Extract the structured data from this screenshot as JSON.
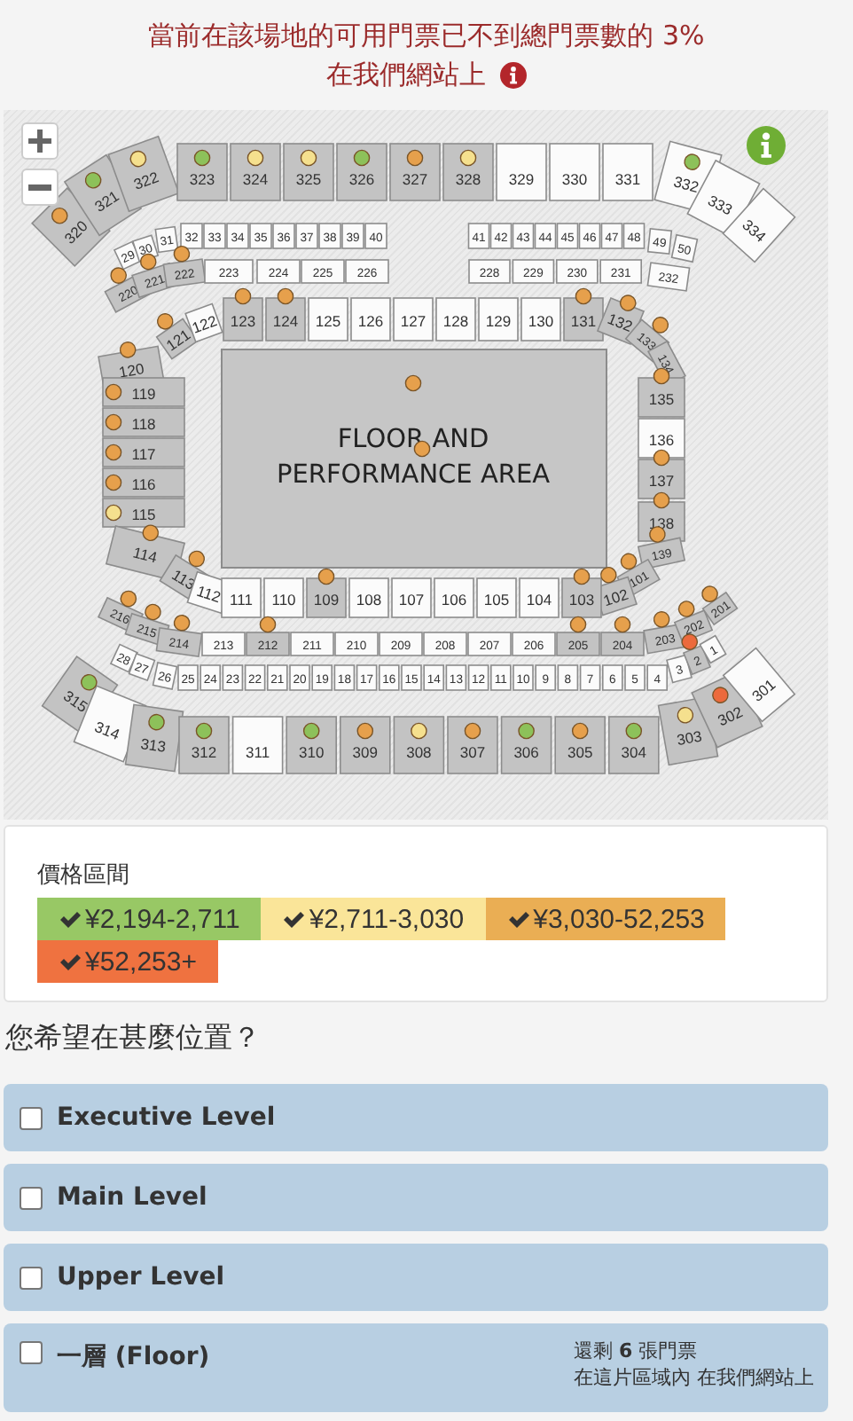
{
  "notice": {
    "line1": "當前在該場地的可用門票已不到總門票數的 3%",
    "line2": "在我們網站上"
  },
  "map": {
    "floor": {
      "lines": [
        "FLOOR AND",
        "PERFORMANCE AREA"
      ],
      "dots": [
        {
          "color": "#e6a04c"
        },
        {
          "color": "#e6a04c"
        }
      ]
    },
    "sections": [
      {
        "label": "320",
        "available": true,
        "color": "#e6a04c"
      },
      {
        "label": "321",
        "available": true,
        "color": "#8dc15a"
      },
      {
        "label": "322",
        "available": true,
        "color": "#f5e08e"
      },
      {
        "label": "323",
        "available": true,
        "color": "#8dc15a"
      },
      {
        "label": "324",
        "available": true,
        "color": "#f5e08e"
      },
      {
        "label": "325",
        "available": true,
        "color": "#f5e08e"
      },
      {
        "label": "326",
        "available": true,
        "color": "#8dc15a"
      },
      {
        "label": "327",
        "available": true,
        "color": "#e6a04c"
      },
      {
        "label": "328",
        "available": true,
        "color": "#f5e08e"
      },
      {
        "label": "329",
        "available": false
      },
      {
        "label": "330",
        "available": false
      },
      {
        "label": "331",
        "available": false
      },
      {
        "label": "332",
        "available": false,
        "color": "#8dc15a"
      },
      {
        "label": "333",
        "available": false
      },
      {
        "label": "334",
        "available": false
      },
      {
        "label": "29",
        "available": false
      },
      {
        "label": "30",
        "available": false
      },
      {
        "label": "31",
        "available": false
      },
      {
        "label": "32",
        "available": false
      },
      {
        "label": "33",
        "available": false
      },
      {
        "label": "34",
        "available": false
      },
      {
        "label": "35",
        "available": false
      },
      {
        "label": "36",
        "available": false
      },
      {
        "label": "37",
        "available": false
      },
      {
        "label": "38",
        "available": false
      },
      {
        "label": "39",
        "available": false
      },
      {
        "label": "40",
        "available": false
      },
      {
        "label": "41",
        "available": false
      },
      {
        "label": "42",
        "available": false
      },
      {
        "label": "43",
        "available": false
      },
      {
        "label": "44",
        "available": false
      },
      {
        "label": "45",
        "available": false
      },
      {
        "label": "46",
        "available": false
      },
      {
        "label": "47",
        "available": false
      },
      {
        "label": "48",
        "available": false
      },
      {
        "label": "49",
        "available": false
      },
      {
        "label": "50",
        "available": false
      },
      {
        "label": "220",
        "available": true,
        "color": "#e6a04c"
      },
      {
        "label": "221",
        "available": true,
        "color": "#e6a04c"
      },
      {
        "label": "222",
        "available": true,
        "color": "#e6a04c"
      },
      {
        "label": "223",
        "available": false
      },
      {
        "label": "224",
        "available": false
      },
      {
        "label": "225",
        "available": false
      },
      {
        "label": "226",
        "available": false
      },
      {
        "label": "228",
        "available": false
      },
      {
        "label": "229",
        "available": false
      },
      {
        "label": "230",
        "available": false
      },
      {
        "label": "231",
        "available": false
      },
      {
        "label": "232",
        "available": false
      },
      {
        "label": "121",
        "available": true,
        "color": "#e6a04c"
      },
      {
        "label": "122",
        "available": false
      },
      {
        "label": "123",
        "available": true,
        "color": "#e6a04c"
      },
      {
        "label": "124",
        "available": true,
        "color": "#e6a04c"
      },
      {
        "label": "125",
        "available": false
      },
      {
        "label": "126",
        "available": false
      },
      {
        "label": "127",
        "available": false
      },
      {
        "label": "128",
        "available": false
      },
      {
        "label": "129",
        "available": false
      },
      {
        "label": "130",
        "available": false
      },
      {
        "label": "131",
        "available": true,
        "color": "#e6a04c"
      },
      {
        "label": "132",
        "available": true,
        "color": "#e6a04c"
      },
      {
        "label": "133",
        "available": true,
        "color": "#e6a04c"
      },
      {
        "label": "134",
        "available": true
      },
      {
        "label": "120",
        "available": true,
        "color": "#e6a04c"
      },
      {
        "label": "119",
        "available": true,
        "color": "#e6a04c"
      },
      {
        "label": "118",
        "available": true,
        "color": "#e6a04c"
      },
      {
        "label": "117",
        "available": true,
        "color": "#e6a04c"
      },
      {
        "label": "116",
        "available": true,
        "color": "#e6a04c"
      },
      {
        "label": "115",
        "available": true,
        "color": "#f5e08e"
      },
      {
        "label": "114",
        "available": true,
        "color": "#e6a04c"
      },
      {
        "label": "113",
        "available": true,
        "color": "#e6a04c"
      },
      {
        "label": "112",
        "available": false
      },
      {
        "label": "135",
        "available": true,
        "color": "#e6a04c"
      },
      {
        "label": "136",
        "available": false
      },
      {
        "label": "137",
        "available": true,
        "color": "#e6a04c"
      },
      {
        "label": "138",
        "available": true,
        "color": "#e6a04c"
      },
      {
        "label": "139",
        "available": true,
        "color": "#e6a04c"
      },
      {
        "label": "101",
        "available": true,
        "color": "#e6a04c"
      },
      {
        "label": "102",
        "available": true,
        "color": "#e6a04c"
      },
      {
        "label": "111",
        "available": false
      },
      {
        "label": "110",
        "available": false
      },
      {
        "label": "109",
        "available": true,
        "color": "#e6a04c"
      },
      {
        "label": "108",
        "available": false
      },
      {
        "label": "107",
        "available": false
      },
      {
        "label": "106",
        "available": false
      },
      {
        "label": "105",
        "available": false
      },
      {
        "label": "104",
        "available": false
      },
      {
        "label": "103",
        "available": true,
        "color": "#e6a04c"
      },
      {
        "label": "216",
        "available": true,
        "color": "#e6a04c"
      },
      {
        "label": "215",
        "available": true,
        "color": "#e6a04c"
      },
      {
        "label": "214",
        "available": true,
        "color": "#e6a04c"
      },
      {
        "label": "213",
        "available": false
      },
      {
        "label": "212",
        "available": true,
        "color": "#e6a04c"
      },
      {
        "label": "211",
        "available": false
      },
      {
        "label": "210",
        "available": false
      },
      {
        "label": "209",
        "available": false
      },
      {
        "label": "208",
        "available": false
      },
      {
        "label": "207",
        "available": false
      },
      {
        "label": "206",
        "available": false
      },
      {
        "label": "205",
        "available": true,
        "color": "#e6a04c"
      },
      {
        "label": "204",
        "available": true,
        "color": "#e6a04c"
      },
      {
        "label": "203",
        "available": true,
        "color": "#e6a04c"
      },
      {
        "label": "202",
        "available": true,
        "color": "#e6a04c"
      },
      {
        "label": "201",
        "available": true,
        "color": "#e6a04c"
      },
      {
        "label": "28",
        "available": false
      },
      {
        "label": "27",
        "available": false
      },
      {
        "label": "26",
        "available": false
      },
      {
        "label": "25",
        "available": false
      },
      {
        "label": "24",
        "available": false
      },
      {
        "label": "23",
        "available": false
      },
      {
        "label": "22",
        "available": false
      },
      {
        "label": "21",
        "available": false
      },
      {
        "label": "20",
        "available": false
      },
      {
        "label": "19",
        "available": false
      },
      {
        "label": "18",
        "available": false
      },
      {
        "label": "17",
        "available": false
      },
      {
        "label": "16",
        "available": false
      },
      {
        "label": "15",
        "available": false
      },
      {
        "label": "14",
        "available": false
      },
      {
        "label": "13",
        "available": false
      },
      {
        "label": "12",
        "available": false
      },
      {
        "label": "11",
        "available": false
      },
      {
        "label": "10",
        "available": false
      },
      {
        "label": "9",
        "available": false
      },
      {
        "label": "8",
        "available": false
      },
      {
        "label": "7",
        "available": false
      },
      {
        "label": "6",
        "available": false
      },
      {
        "label": "5",
        "available": false
      },
      {
        "label": "4",
        "available": false
      },
      {
        "label": "3",
        "available": false
      },
      {
        "label": "2",
        "available": true,
        "color": "#ec6a3c"
      },
      {
        "label": "1",
        "available": false
      },
      {
        "label": "315",
        "available": true,
        "color": "#8dc15a"
      },
      {
        "label": "314",
        "available": false
      },
      {
        "label": "313",
        "available": true,
        "color": "#8dc15a"
      },
      {
        "label": "312",
        "available": true,
        "color": "#8dc15a"
      },
      {
        "label": "311",
        "available": false
      },
      {
        "label": "310",
        "available": true,
        "color": "#8dc15a"
      },
      {
        "label": "309",
        "available": true,
        "color": "#e6a04c"
      },
      {
        "label": "308",
        "available": true,
        "color": "#f5e08e"
      },
      {
        "label": "307",
        "available": true,
        "color": "#e6a04c"
      },
      {
        "label": "306",
        "available": true,
        "color": "#8dc15a"
      },
      {
        "label": "305",
        "available": true,
        "color": "#e6a04c"
      },
      {
        "label": "304",
        "available": true,
        "color": "#8dc15a"
      },
      {
        "label": "303",
        "available": true,
        "color": "#f5e08e"
      },
      {
        "label": "302",
        "available": true,
        "color": "#ec6a3c"
      },
      {
        "label": "301",
        "available": false
      }
    ]
  },
  "legend": {
    "title": "價格區間",
    "items": [
      {
        "label": "¥2,194-2,711",
        "color": "#98c865",
        "selected": true
      },
      {
        "label": "¥2,711-3,030",
        "color": "#fae599",
        "selected": true
      },
      {
        "label": "¥3,030-52,253",
        "color": "#eaae54",
        "selected": true
      },
      {
        "label": "¥52,253+",
        "color": "#ef7240",
        "selected": true
      }
    ]
  },
  "question": "您希望在甚麼位置？",
  "options": [
    {
      "label": "Executive Level",
      "checked": false
    },
    {
      "label": "Main Level",
      "checked": false
    },
    {
      "label": "Upper Level",
      "checked": false
    },
    {
      "label": "一層 (Floor)",
      "checked": false,
      "note": [
        "還剩 **6** 張門票",
        "在這片區域內 在我們網站上"
      ]
    }
  ]
}
